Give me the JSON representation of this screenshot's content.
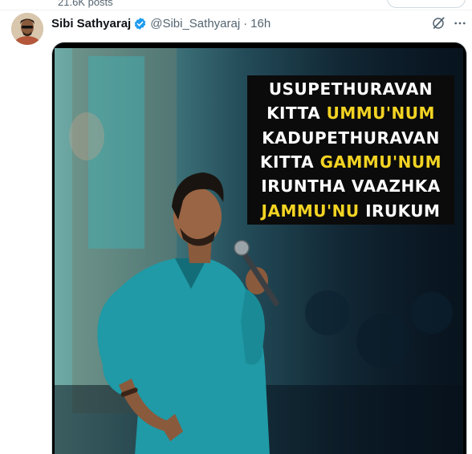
{
  "top": {
    "posts_count": "21.6K posts"
  },
  "tweet": {
    "display_name": "Sibi Sathyaraj",
    "handle": "@Sibi_Sathyaraj",
    "separator": "·",
    "timestamp": "16h",
    "verified": true,
    "icons": {
      "verified": "verified-badge-icon",
      "grok": "grok-icon",
      "more": "more-icon"
    }
  },
  "media": {
    "quote_lines": [
      {
        "a": "USUPETHURAVAN",
        "b": "",
        "c": ""
      },
      {
        "a": "KITTA ",
        "b": "UMMU'NUM",
        "c": ""
      },
      {
        "a": "KADUPETHURAVAN",
        "b": "",
        "c": ""
      },
      {
        "a": "KITTA ",
        "b": "GAMMU'NUM",
        "c": ""
      },
      {
        "a": "IRUNTHA VAAZHKA",
        "b": "",
        "c": ""
      },
      {
        "a": "",
        "b": "JAMMU'NU",
        "c": " IRUKUM"
      }
    ]
  },
  "colors": {
    "accent": "#1d9bf0",
    "secondary_text": "#536471",
    "quote_highlight": "#f2d323",
    "shirt": "#1f9aa6"
  }
}
